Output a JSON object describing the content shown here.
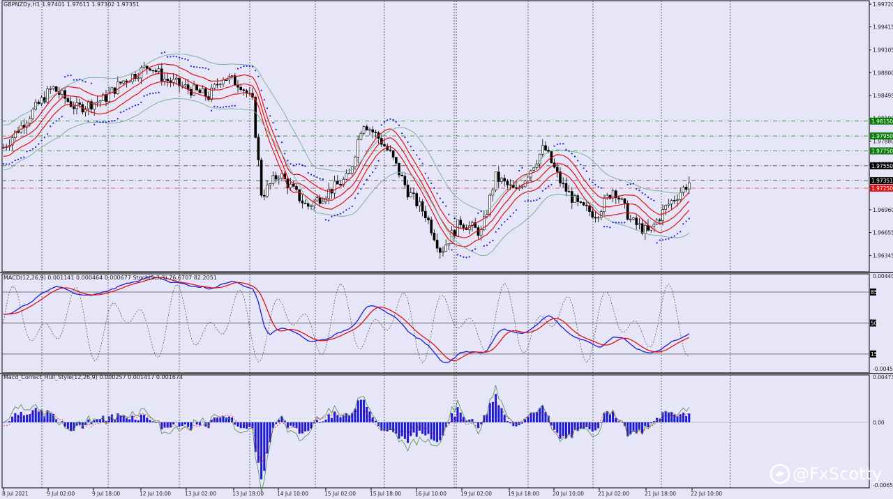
{
  "main": {
    "header": "GBPNZDy,H1  1.97401 1.97611 1.97302 1.97351",
    "price_levels": [
      "1.99720",
      "1.99415",
      "1.99105",
      "1.98800",
      "1.98495",
      "1.98190",
      "1.97880",
      "1.97570",
      "1.97265",
      "1.96960",
      "1.96655",
      "1.96345"
    ],
    "tags": [
      {
        "label": "1.98150",
        "price": 1.9815,
        "color": "#0a7a0a"
      },
      {
        "label": "1.97950",
        "price": 1.9795,
        "color": "#0a7a0a"
      },
      {
        "label": "1.97750",
        "price": 1.9775,
        "color": "#0a7a0a"
      },
      {
        "label": "1.97550",
        "price": 1.9755,
        "color": "#000000"
      },
      {
        "label": "1.97351",
        "price": 1.97351,
        "color": "#000000"
      },
      {
        "label": "1.97250",
        "price": 1.9725,
        "color": "#dd1111"
      }
    ]
  },
  "macd_panel": {
    "header": "MACD(12,26,9) 0.001141 0.000464 0.000677  Stoch(5,3,3) 76.6707 82.2051",
    "scale_top": "0.004406",
    "scale_bottom": "-0.00451",
    "levels": [
      "85",
      "50",
      "15"
    ]
  },
  "hull_panel": {
    "header": "Macd_Correct_Hull_Style(12,26,9) 0.000257 0.001417 0.001674",
    "scale_top": "0.004734",
    "scale_mid": "0.00",
    "scale_bottom": "-0.006529"
  },
  "time_axis": [
    "8 Jul 2021",
    "9 Jul 02:00",
    "9 Jul 18:00",
    "12 Jul 10:00",
    "13 Jul 02:00",
    "13 Jul 18:00",
    "14 Jul 10:00",
    "15 Jul 02:00",
    "15 Jul 18:00",
    "16 Jul 10:00",
    "19 Jul 02:00",
    "19 Jul 18:00",
    "20 Jul 10:00",
    "21 Jul 02:00",
    "21 Jul 18:00",
    "22 Jul 10:00"
  ],
  "watermark": "@FxScotty",
  "colors": {
    "background": "#e6e6f8",
    "candle": "#000000",
    "ma_red": "#e01010",
    "bands_green": "#6fae90",
    "psar": "#1a1ad8",
    "macd_blue": "#1a1ad8",
    "signal_red": "#e01010",
    "hist_blue": "#1a1ad8"
  }
}
